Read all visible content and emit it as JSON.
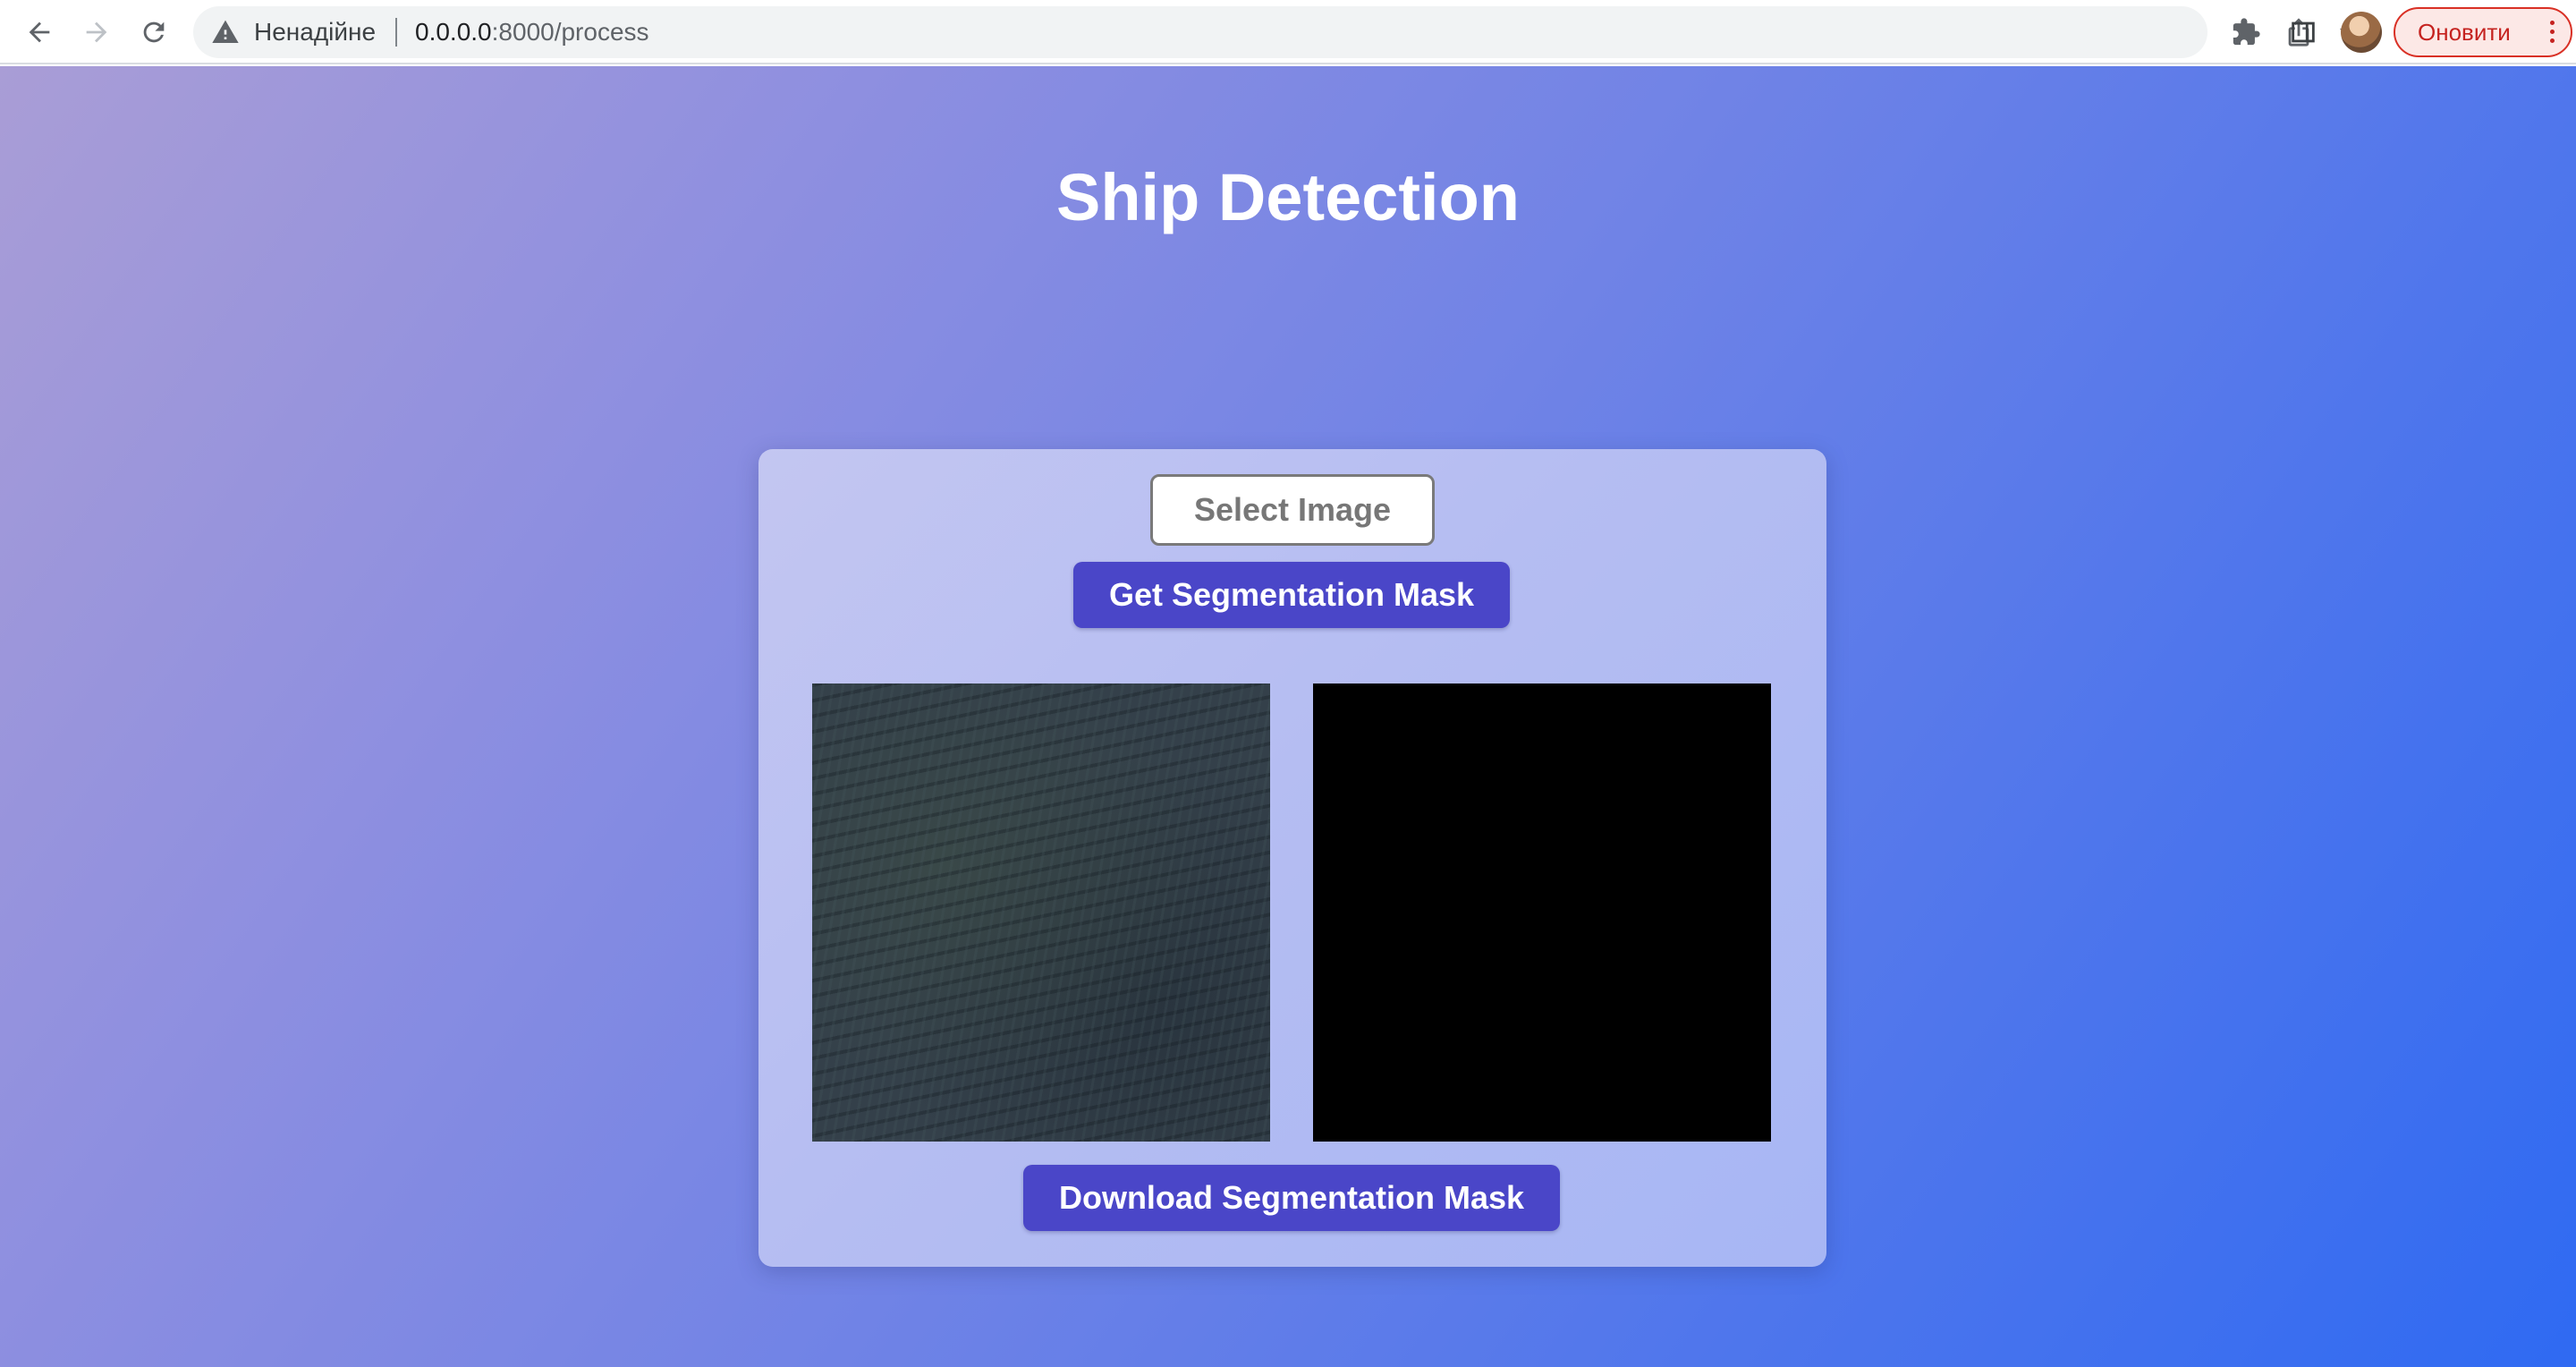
{
  "browser": {
    "security_label": "Ненадійне",
    "url_host": "0.0.0.0",
    "url_rest": ":8000/process",
    "update_button_label": "Оновити",
    "icons": [
      "back-arrow-icon",
      "forward-arrow-icon",
      "reload-icon",
      "warning-icon",
      "share-icon",
      "star-icon",
      "extensions-icon",
      "side-panel-icon",
      "profile-avatar",
      "menu-dots-icon"
    ]
  },
  "page": {
    "title": "Ship Detection",
    "select_button_label": "Select Image",
    "get_mask_button_label": "Get Segmentation Mask",
    "download_button_label": "Download Segmentation Mask"
  },
  "colors": {
    "gradient_start": "#a99dd6",
    "gradient_end": "#2f6af2",
    "button_primary": "#4a46c8",
    "update_button": "#c5221f"
  }
}
